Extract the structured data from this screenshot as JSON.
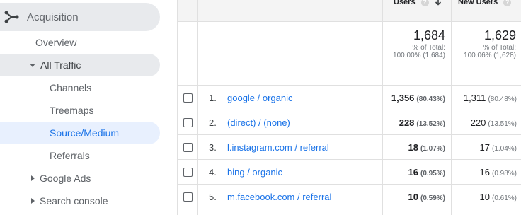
{
  "sidebar": {
    "section": "Acquisition",
    "items": [
      {
        "label": "Overview"
      },
      {
        "label": "All Traffic"
      },
      {
        "label": "Channels"
      },
      {
        "label": "Treemaps"
      },
      {
        "label": "Source/Medium"
      },
      {
        "label": "Referrals"
      },
      {
        "label": "Google Ads"
      },
      {
        "label": "Search console"
      }
    ]
  },
  "table": {
    "columns": {
      "users": "Users",
      "new_users": "New Users"
    },
    "totals": {
      "users": {
        "value": "1,684",
        "pct_label": "% of Total:",
        "pct_value": "100.00% (1,684)"
      },
      "new_users": {
        "value": "1,629",
        "pct_label": "% of Total:",
        "pct_value": "100.06% (1,628)"
      }
    },
    "rows": [
      {
        "num": "1.",
        "source": "google / organic",
        "users": "1,356",
        "users_pct": "(80.43%)",
        "new_users": "1,311",
        "new_users_pct": "(80.48%)"
      },
      {
        "num": "2.",
        "source": "(direct) / (none)",
        "users": "228",
        "users_pct": "(13.52%)",
        "new_users": "220",
        "new_users_pct": "(13.51%)"
      },
      {
        "num": "3.",
        "source": "l.instagram.com / referral",
        "users": "18",
        "users_pct": "(1.07%)",
        "new_users": "17",
        "new_users_pct": "(1.04%)"
      },
      {
        "num": "4.",
        "source": "bing / organic",
        "users": "16",
        "users_pct": "(0.95%)",
        "new_users": "16",
        "new_users_pct": "(0.98%)"
      },
      {
        "num": "5.",
        "source": "m.facebook.com / referral",
        "users": "10",
        "users_pct": "(0.59%)",
        "new_users": "10",
        "new_users_pct": "(0.61%)"
      }
    ]
  },
  "icons": {
    "acquisition": "acquisition-icon",
    "help": "help-icon",
    "sort": "sort-down-icon"
  },
  "colors": {
    "link": "#1a73e8",
    "active_bg": "#e8f0fe",
    "hover_bg": "#e8eaed"
  }
}
